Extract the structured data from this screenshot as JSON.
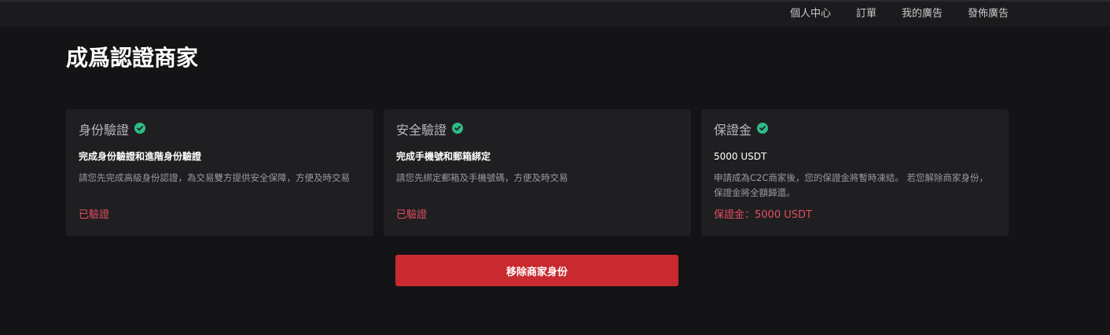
{
  "nav": {
    "items": [
      "個人中心",
      "訂單",
      "我的廣告",
      "發佈廣告"
    ]
  },
  "page": {
    "title": "成爲認證商家"
  },
  "cards": [
    {
      "title": "身份驗證",
      "icon": "check-circle-icon",
      "subtitle": "完成身份驗證和進階身份驗證",
      "description": "請您先完成高級身份認證，為交易雙方提供安全保障，方便及時交易",
      "status": "已驗證"
    },
    {
      "title": "安全驗證",
      "icon": "check-circle-icon",
      "subtitle": "完成手機號和郵箱綁定",
      "description": "請您先綁定郵箱及手機號碼，方便及時交易",
      "status": "已驗證"
    },
    {
      "title": "保證金",
      "icon": "check-circle-icon",
      "subtitle": "5000 USDT",
      "description": "申請成為C2C商家後，您的保證金將暫時凍結。 若您解除商家身份，保證金將全額歸還。",
      "status": "保證金：5000 USDT"
    }
  ],
  "actions": {
    "remove_label": "移除商家身份"
  },
  "colors": {
    "accent_red": "#c92a2f",
    "status_red": "#e04f5f",
    "check_green": "#2ebd85"
  }
}
